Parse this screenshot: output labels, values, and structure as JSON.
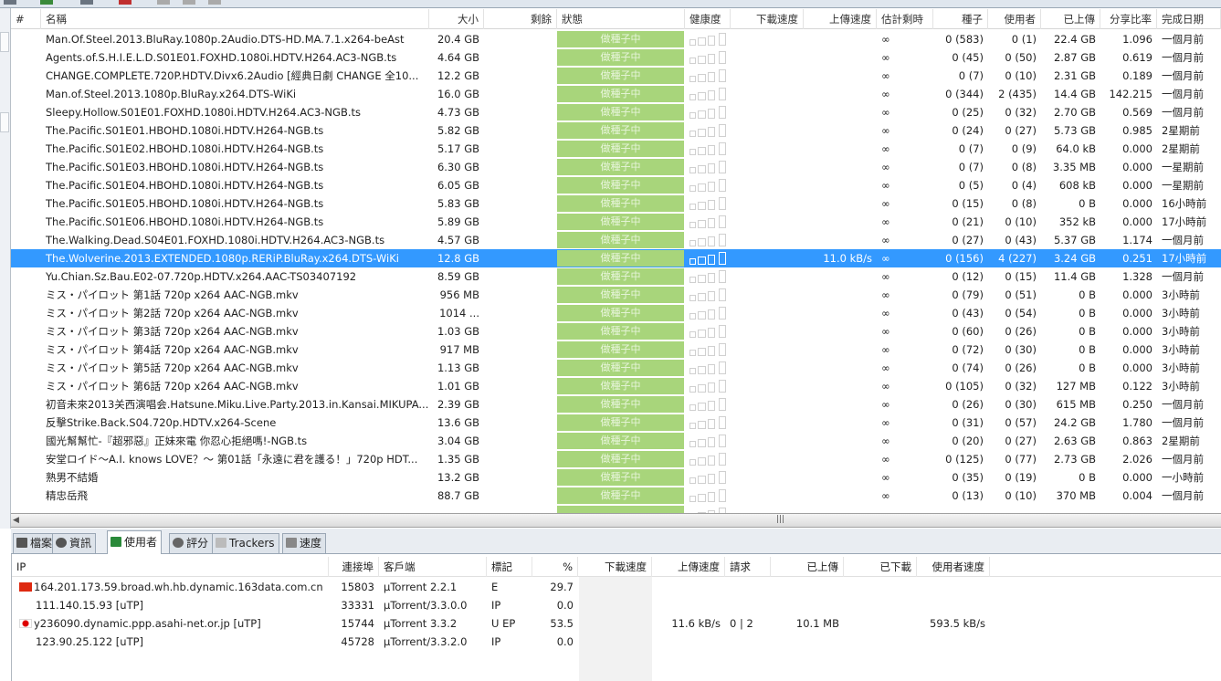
{
  "columns": [
    "#",
    "名稱",
    "大小",
    "剩餘",
    "狀態",
    "健康度",
    "下載速度",
    "上傳速度",
    "估計剩時",
    "種子",
    "使用者",
    "已上傳",
    "分享比率",
    "完成日期"
  ],
  "status_label": "做種子中",
  "selected_index": 12,
  "colors": {
    "status": "#a8d57b",
    "selected": "#3399ff"
  },
  "torrents": [
    {
      "name": "Man.Of.Steel.2013.BluRay.1080p.2Audio.DTS-HD.MA.7.1.x264-beAst",
      "size": "20.4 GB",
      "dl": "",
      "ul": "",
      "eta": "∞",
      "seeds": "0 (583)",
      "peers": "0 (1)",
      "uploaded": "22.4 GB",
      "ratio": "1.096",
      "done": "一個月前"
    },
    {
      "name": "Agents.of.S.H.I.E.L.D.S01E01.FOXHD.1080i.HDTV.H264.AC3-NGB.ts",
      "size": "4.64 GB",
      "dl": "",
      "ul": "",
      "eta": "∞",
      "seeds": "0 (45)",
      "peers": "0 (50)",
      "uploaded": "2.87 GB",
      "ratio": "0.619",
      "done": "一個月前"
    },
    {
      "name": "CHANGE.COMPLETE.720P.HDTV.Divx6.2Audio [經典日劇 CHANGE 全10...",
      "size": "12.2 GB",
      "dl": "",
      "ul": "",
      "eta": "∞",
      "seeds": "0 (7)",
      "peers": "0 (10)",
      "uploaded": "2.31 GB",
      "ratio": "0.189",
      "done": "一個月前"
    },
    {
      "name": "Man.of.Steel.2013.1080p.BluRay.x264.DTS-WiKi",
      "size": "16.0 GB",
      "dl": "",
      "ul": "",
      "eta": "∞",
      "seeds": "0 (344)",
      "peers": "2 (435)",
      "uploaded": "14.4 GB",
      "ratio": "142.215",
      "done": "一個月前"
    },
    {
      "name": "Sleepy.Hollow.S01E01.FOXHD.1080i.HDTV.H264.AC3-NGB.ts",
      "size": "4.73 GB",
      "dl": "",
      "ul": "",
      "eta": "∞",
      "seeds": "0 (25)",
      "peers": "0 (32)",
      "uploaded": "2.70 GB",
      "ratio": "0.569",
      "done": "一個月前"
    },
    {
      "name": "The.Pacific.S01E01.HBOHD.1080i.HDTV.H264-NGB.ts",
      "size": "5.82 GB",
      "dl": "",
      "ul": "",
      "eta": "∞",
      "seeds": "0 (24)",
      "peers": "0 (27)",
      "uploaded": "5.73 GB",
      "ratio": "0.985",
      "done": "2星期前"
    },
    {
      "name": "The.Pacific.S01E02.HBOHD.1080i.HDTV.H264-NGB.ts",
      "size": "5.17 GB",
      "dl": "",
      "ul": "",
      "eta": "∞",
      "seeds": "0 (7)",
      "peers": "0 (9)",
      "uploaded": "64.0 kB",
      "ratio": "0.000",
      "done": "2星期前"
    },
    {
      "name": "The.Pacific.S01E03.HBOHD.1080i.HDTV.H264-NGB.ts",
      "size": "6.30 GB",
      "dl": "",
      "ul": "",
      "eta": "∞",
      "seeds": "0 (7)",
      "peers": "0 (8)",
      "uploaded": "3.35 MB",
      "ratio": "0.000",
      "done": "一星期前"
    },
    {
      "name": "The.Pacific.S01E04.HBOHD.1080i.HDTV.H264-NGB.ts",
      "size": "6.05 GB",
      "dl": "",
      "ul": "",
      "eta": "∞",
      "seeds": "0 (5)",
      "peers": "0 (4)",
      "uploaded": "608 kB",
      "ratio": "0.000",
      "done": "一星期前"
    },
    {
      "name": "The.Pacific.S01E05.HBOHD.1080i.HDTV.H264-NGB.ts",
      "size": "5.83 GB",
      "dl": "",
      "ul": "",
      "eta": "∞",
      "seeds": "0 (15)",
      "peers": "0 (8)",
      "uploaded": "0 B",
      "ratio": "0.000",
      "done": "16小時前"
    },
    {
      "name": "The.Pacific.S01E06.HBOHD.1080i.HDTV.H264-NGB.ts",
      "size": "5.89 GB",
      "dl": "",
      "ul": "",
      "eta": "∞",
      "seeds": "0 (21)",
      "peers": "0 (10)",
      "uploaded": "352 kB",
      "ratio": "0.000",
      "done": "17小時前"
    },
    {
      "name": "The.Walking.Dead.S04E01.FOXHD.1080i.HDTV.H264.AC3-NGB.ts",
      "size": "4.57 GB",
      "dl": "",
      "ul": "",
      "eta": "∞",
      "seeds": "0 (27)",
      "peers": "0 (43)",
      "uploaded": "5.37 GB",
      "ratio": "1.174",
      "done": "一個月前"
    },
    {
      "name": "The.Wolverine.2013.EXTENDED.1080p.RERiP.BluRay.x264.DTS-WiKi",
      "size": "12.8 GB",
      "dl": "",
      "ul": "11.0 kB/s",
      "eta": "∞",
      "seeds": "0 (156)",
      "peers": "4 (227)",
      "uploaded": "3.24 GB",
      "ratio": "0.251",
      "done": "17小時前"
    },
    {
      "name": "Yu.Chian.Sz.Bau.E02-07.720p.HDTV.x264.AAC-TS03407192",
      "size": "8.59 GB",
      "dl": "",
      "ul": "",
      "eta": "∞",
      "seeds": "0 (12)",
      "peers": "0 (15)",
      "uploaded": "11.4 GB",
      "ratio": "1.328",
      "done": "一個月前"
    },
    {
      "name": "ミス・パイロット 第1話 720p x264 AAC-NGB.mkv",
      "size": "956 MB",
      "dl": "",
      "ul": "",
      "eta": "∞",
      "seeds": "0 (79)",
      "peers": "0 (51)",
      "uploaded": "0 B",
      "ratio": "0.000",
      "done": "3小時前"
    },
    {
      "name": "ミス・パイロット 第2話 720p x264 AAC-NGB.mkv",
      "size": "1014 ...",
      "dl": "",
      "ul": "",
      "eta": "∞",
      "seeds": "0 (43)",
      "peers": "0 (54)",
      "uploaded": "0 B",
      "ratio": "0.000",
      "done": "3小時前"
    },
    {
      "name": "ミス・パイロット 第3話 720p x264 AAC-NGB.mkv",
      "size": "1.03 GB",
      "dl": "",
      "ul": "",
      "eta": "∞",
      "seeds": "0 (60)",
      "peers": "0 (26)",
      "uploaded": "0 B",
      "ratio": "0.000",
      "done": "3小時前"
    },
    {
      "name": "ミス・パイロット 第4話 720p x264 AAC-NGB.mkv",
      "size": "917 MB",
      "dl": "",
      "ul": "",
      "eta": "∞",
      "seeds": "0 (72)",
      "peers": "0 (30)",
      "uploaded": "0 B",
      "ratio": "0.000",
      "done": "3小時前"
    },
    {
      "name": "ミス・パイロット 第5話 720p x264 AAC-NGB.mkv",
      "size": "1.13 GB",
      "dl": "",
      "ul": "",
      "eta": "∞",
      "seeds": "0 (74)",
      "peers": "0 (26)",
      "uploaded": "0 B",
      "ratio": "0.000",
      "done": "3小時前"
    },
    {
      "name": "ミス・パイロット 第6話 720p x264 AAC-NGB.mkv",
      "size": "1.01 GB",
      "dl": "",
      "ul": "",
      "eta": "∞",
      "seeds": "0 (105)",
      "peers": "0 (32)",
      "uploaded": "127 MB",
      "ratio": "0.122",
      "done": "3小時前"
    },
    {
      "name": "初音未來2013关西演唱会.Hatsune.Miku.Live.Party.2013.in.Kansai.MIKUPA....",
      "size": "2.39 GB",
      "dl": "",
      "ul": "",
      "eta": "∞",
      "seeds": "0 (26)",
      "peers": "0 (30)",
      "uploaded": "615 MB",
      "ratio": "0.250",
      "done": "一個月前"
    },
    {
      "name": "反擊Strike.Back.S04.720p.HDTV.x264-Scene",
      "size": "13.6 GB",
      "dl": "",
      "ul": "",
      "eta": "∞",
      "seeds": "0 (31)",
      "peers": "0 (57)",
      "uploaded": "24.2 GB",
      "ratio": "1.780",
      "done": "一個月前"
    },
    {
      "name": "國光幫幫忙-『超邪惡』正妹來電 你忍心拒絕嗎!-NGB.ts",
      "size": "3.04 GB",
      "dl": "",
      "ul": "",
      "eta": "∞",
      "seeds": "0 (20)",
      "peers": "0 (27)",
      "uploaded": "2.63 GB",
      "ratio": "0.863",
      "done": "2星期前"
    },
    {
      "name": "安堂ロイド～A.I. knows LOVE？～ 第01話「永遠に君を護る！」720p HDT...",
      "size": "1.35 GB",
      "dl": "",
      "ul": "",
      "eta": "∞",
      "seeds": "0 (125)",
      "peers": "0 (77)",
      "uploaded": "2.73 GB",
      "ratio": "2.026",
      "done": "一個月前"
    },
    {
      "name": "熟男不結婚",
      "size": "13.2 GB",
      "dl": "",
      "ul": "",
      "eta": "∞",
      "seeds": "0 (35)",
      "peers": "0 (19)",
      "uploaded": "0 B",
      "ratio": "0.000",
      "done": "一小時前"
    },
    {
      "name": "精忠岳飛",
      "size": "88.7 GB",
      "dl": "",
      "ul": "",
      "eta": "∞",
      "seeds": "0 (13)",
      "peers": "0 (10)",
      "uploaded": "370 MB",
      "ratio": "0.004",
      "done": "一個月前"
    }
  ],
  "tabs": [
    {
      "label": "檔案",
      "icon": "folder-icon"
    },
    {
      "label": "資訊",
      "icon": "info-icon"
    },
    {
      "label": "使用者",
      "icon": "users-icon",
      "active": true
    },
    {
      "label": "評分",
      "icon": "comment-icon"
    },
    {
      "label": "Trackers",
      "icon": "trackers-icon"
    },
    {
      "label": "速度",
      "icon": "chart-icon"
    }
  ],
  "peer_columns": [
    "IP",
    "連接埠",
    "客戶端",
    "標記",
    "%",
    "下載速度",
    "上傳速度",
    "請求",
    "已上傳",
    "已下載",
    "使用者速度"
  ],
  "peers": [
    {
      "flag": "cn",
      "ip": "164.201.173.59.broad.wh.hb.dynamic.163data.com.cn",
      "port": "15803",
      "client": "µTorrent 2.2.1",
      "flags": "E",
      "pct": "29.7",
      "dl": "",
      "ul": "",
      "req": "",
      "up": "",
      "down": "",
      "speed": ""
    },
    {
      "flag": "",
      "ip": "111.140.15.93 [uTP]",
      "port": "33331",
      "client": "µTorrent/3.3.0.0",
      "flags": "IP",
      "pct": "0.0",
      "dl": "",
      "ul": "",
      "req": "",
      "up": "",
      "down": "",
      "speed": ""
    },
    {
      "flag": "jp",
      "ip": "y236090.dynamic.ppp.asahi-net.or.jp [uTP]",
      "port": "15744",
      "client": "µTorrent 3.3.2",
      "flags": "U EP",
      "pct": "53.5",
      "dl": "",
      "ul": "11.6 kB/s",
      "req": "0 | 2",
      "up": "10.1 MB",
      "down": "",
      "speed": "593.5 kB/s"
    },
    {
      "flag": "",
      "ip": "123.90.25.122 [uTP]",
      "port": "45728",
      "client": "µTorrent/3.3.2.0",
      "flags": "IP",
      "pct": "0.0",
      "dl": "",
      "ul": "",
      "req": "",
      "up": "",
      "down": "",
      "speed": ""
    }
  ]
}
